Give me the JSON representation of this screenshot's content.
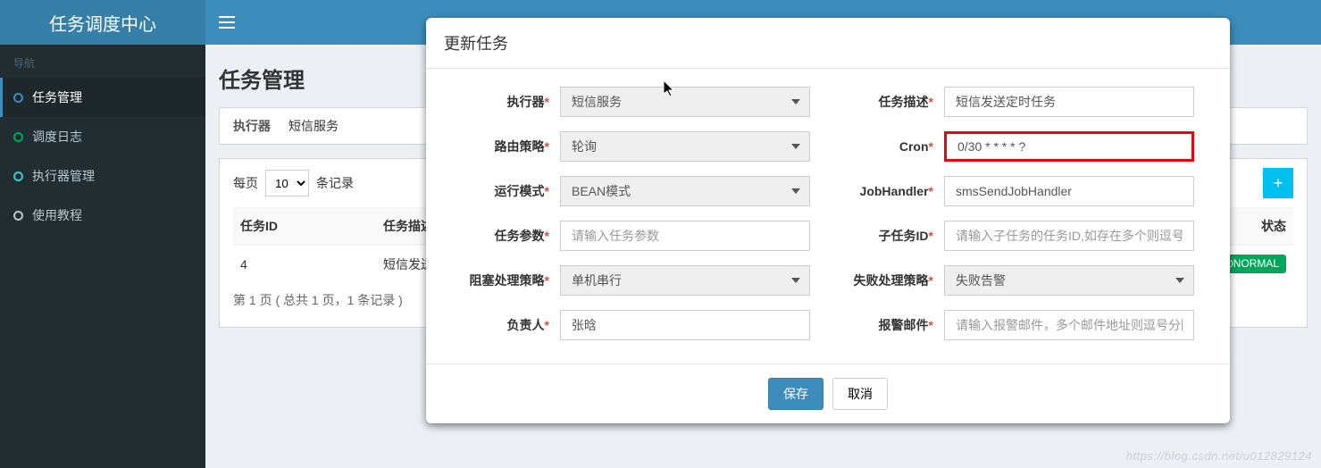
{
  "brand": "任务调度中心",
  "nav": {
    "header": "导航",
    "items": [
      {
        "label": "任务管理",
        "color": "c-blue",
        "active": true
      },
      {
        "label": "调度日志",
        "color": "c-green",
        "active": false
      },
      {
        "label": "执行器管理",
        "color": "c-teal",
        "active": false
      },
      {
        "label": "使用教程",
        "color": "c-gray",
        "active": false
      }
    ]
  },
  "page": {
    "title": "任务管理",
    "filter_label": "执行器",
    "filter_value": "短信服务",
    "perpage_prefix": "每页",
    "perpage_value": "10",
    "perpage_suffix": "条记录",
    "columns": {
      "id": "任务ID",
      "desc": "任务描述",
      "status": "状态"
    },
    "rows": [
      {
        "id": "4",
        "desc": "短信发送",
        "status": "NORMAL"
      }
    ],
    "pager": "第 1 页 ( 总共 1 页，1 条记录 )"
  },
  "modal": {
    "title": "更新任务",
    "left": [
      {
        "label": "执行器",
        "req": true,
        "type": "sel",
        "value": "短信服务"
      },
      {
        "label": "路由策略",
        "req": true,
        "type": "sel",
        "value": "轮询"
      },
      {
        "label": "运行模式",
        "req": true,
        "type": "sel",
        "value": "BEAN模式"
      },
      {
        "label": "任务参数",
        "req": true,
        "type": "text",
        "value": "",
        "placeholder": "请输入任务参数"
      },
      {
        "label": "阻塞处理策略",
        "req": true,
        "type": "sel",
        "value": "单机串行"
      },
      {
        "label": "负责人",
        "req": true,
        "type": "text",
        "value": "张晗",
        "placeholder": ""
      }
    ],
    "right": [
      {
        "label": "任务描述",
        "req": true,
        "type": "text",
        "value": "短信发送定时任务",
        "placeholder": ""
      },
      {
        "label": "Cron",
        "req": true,
        "type": "text",
        "value": "0/30 * * * * ?",
        "placeholder": "",
        "highlight": true
      },
      {
        "label": "JobHandler",
        "req": true,
        "type": "text",
        "value": "smsSendJobHandler",
        "placeholder": ""
      },
      {
        "label": "子任务ID",
        "req": true,
        "type": "text",
        "value": "",
        "placeholder": "请输入子任务的任务ID,如存在多个则逗号分隔"
      },
      {
        "label": "失败处理策略",
        "req": true,
        "type": "sel",
        "value": "失败告警"
      },
      {
        "label": "报警邮件",
        "req": true,
        "type": "text",
        "value": "",
        "placeholder": "请输入报警邮件，多个邮件地址则逗号分隔"
      }
    ],
    "save": "保存",
    "cancel": "取消"
  },
  "watermark": "https://blog.csdn.net/u012829124"
}
